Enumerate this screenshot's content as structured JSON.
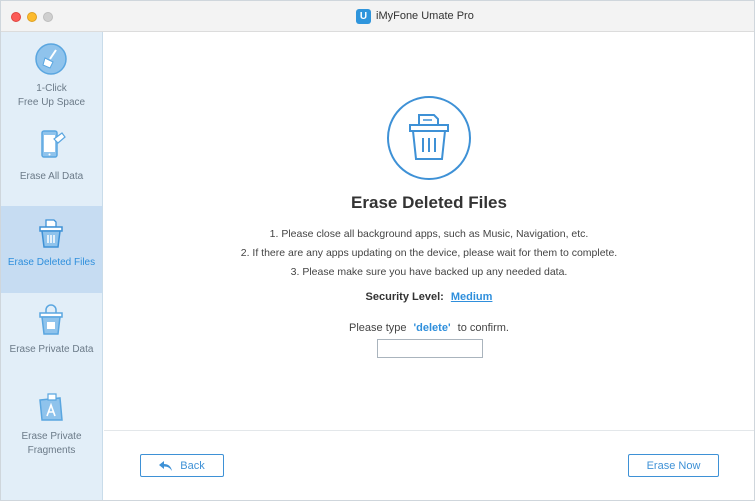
{
  "window": {
    "title": "iMyFone Umate Pro",
    "logo_letter": "U"
  },
  "sidebar": {
    "items": [
      {
        "label_line1": "1-Click",
        "label_line2": "Free Up Space",
        "icon": "broom-icon",
        "active": false
      },
      {
        "label_line1": "Erase All Data",
        "label_line2": "",
        "icon": "phone-erase-icon",
        "active": false
      },
      {
        "label_line1": "Erase Deleted Files",
        "label_line2": "",
        "icon": "trash-icon",
        "active": true
      },
      {
        "label_line1": "Erase Private Data",
        "label_line2": "",
        "icon": "lock-trash-icon",
        "active": false
      },
      {
        "label_line1": "Erase Private",
        "label_line2": "Fragments",
        "icon": "app-fragment-icon",
        "active": false
      }
    ]
  },
  "main": {
    "title": "Erase Deleted Files",
    "steps": [
      "1. Please close all background apps, such as Music, Navigation, etc.",
      "2. If there are any apps updating on the device, please wait for them to complete.",
      "3. Please make sure you have backed up any needed data."
    ],
    "security_label": "Security Level:",
    "security_value": "Medium",
    "confirm_prefix": "Please type",
    "confirm_keyword": "'delete'",
    "confirm_suffix": "to confirm.",
    "confirm_value": ""
  },
  "footer": {
    "back_label": "Back",
    "erase_label": "Erase Now"
  },
  "colors": {
    "accent": "#2f8fdc",
    "sidebar_bg": "#e2eef8",
    "sidebar_active": "#c6dcf2"
  }
}
